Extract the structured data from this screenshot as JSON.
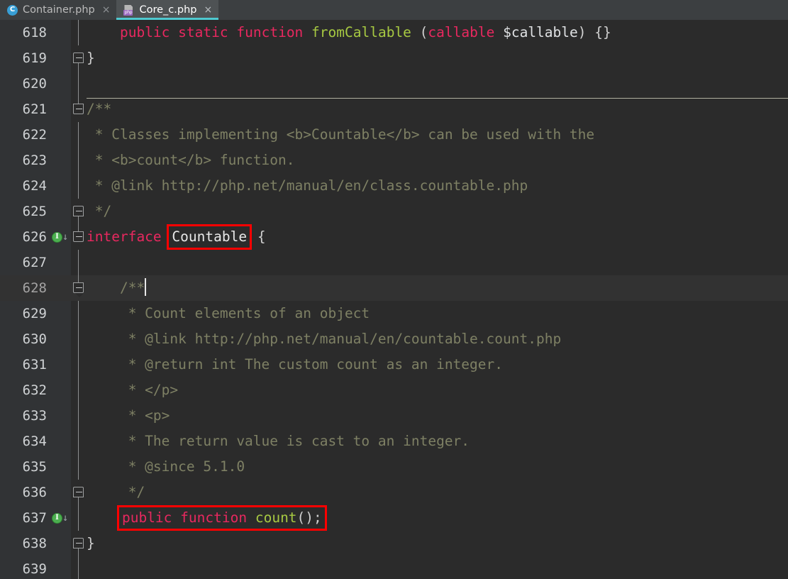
{
  "window": {
    "app": "php-editor",
    "accent_color": "#4ec9d0",
    "background": "#2b2b2b",
    "gutter_background": "#313335",
    "annotation_color": "#fe0000"
  },
  "tabs": [
    {
      "label": "Container.php",
      "icon": "php-class-icon",
      "icon_letter": "C",
      "active": false,
      "close_label": "×"
    },
    {
      "label": "Core_c.php",
      "icon": "php-file-icon",
      "icon_letter": "php",
      "active": true,
      "close_label": "×"
    }
  ],
  "editor": {
    "gutter_marker_letter": "I",
    "gutter_marker_arrow": "↓",
    "fold_collapse_label": "−",
    "lines": [
      {
        "number": "618",
        "fold": "line",
        "marker": false,
        "current": false,
        "tokens": [
          {
            "t": "    ",
            "c": "punc"
          },
          {
            "t": "public",
            "c": "kw"
          },
          {
            "t": " ",
            "c": "punc"
          },
          {
            "t": "static",
            "c": "kw"
          },
          {
            "t": " ",
            "c": "punc"
          },
          {
            "t": "function",
            "c": "kw"
          },
          {
            "t": " ",
            "c": "punc"
          },
          {
            "t": "fromCallable",
            "c": "fn"
          },
          {
            "t": " (",
            "c": "punc"
          },
          {
            "t": "callable",
            "c": "kw"
          },
          {
            "t": " ",
            "c": "punc"
          },
          {
            "t": "$callable",
            "c": "var"
          },
          {
            "t": ") {}",
            "c": "punc"
          }
        ]
      },
      {
        "number": "619",
        "fold": "end",
        "marker": false,
        "current": false,
        "tokens": [
          {
            "t": "}",
            "c": "punc"
          }
        ]
      },
      {
        "number": "620",
        "fold": "line",
        "marker": false,
        "current": false,
        "tokens": []
      },
      {
        "number": "621",
        "fold": "start",
        "marker": false,
        "current": false,
        "tokens": [
          {
            "t": "/**",
            "c": "cmt"
          }
        ]
      },
      {
        "number": "622",
        "fold": "line",
        "marker": false,
        "current": false,
        "tokens": [
          {
            "t": " * Classes implementing <b>Countable</b> can be used with the",
            "c": "cmt"
          }
        ]
      },
      {
        "number": "623",
        "fold": "line",
        "marker": false,
        "current": false,
        "tokens": [
          {
            "t": " * <b>count</b> function.",
            "c": "cmt"
          }
        ]
      },
      {
        "number": "624",
        "fold": "line",
        "marker": false,
        "current": false,
        "tokens": [
          {
            "t": " * @link http://php.net/manual/en/class.countable.php",
            "c": "cmt"
          }
        ]
      },
      {
        "number": "625",
        "fold": "end",
        "marker": false,
        "current": false,
        "tokens": [
          {
            "t": " */",
            "c": "cmt"
          }
        ]
      },
      {
        "number": "626",
        "fold": "start",
        "marker": true,
        "current": false,
        "tokens": [
          {
            "t": "interface",
            "c": "kw"
          },
          {
            "t": " ",
            "c": "punc"
          },
          {
            "t": "Countable",
            "c": "name",
            "annot": true
          },
          {
            "t": " {",
            "c": "punc"
          }
        ]
      },
      {
        "number": "627",
        "fold": "line",
        "marker": false,
        "current": false,
        "tokens": []
      },
      {
        "number": "628",
        "fold": "start",
        "marker": false,
        "current": true,
        "caret": true,
        "tokens": [
          {
            "t": "    /**",
            "c": "cmt"
          }
        ]
      },
      {
        "number": "629",
        "fold": "line",
        "marker": false,
        "current": false,
        "tokens": [
          {
            "t": "     * Count elements of an object",
            "c": "cmt"
          }
        ]
      },
      {
        "number": "630",
        "fold": "line",
        "marker": false,
        "current": false,
        "tokens": [
          {
            "t": "     * @link http://php.net/manual/en/countable.count.php",
            "c": "cmt"
          }
        ]
      },
      {
        "number": "631",
        "fold": "line",
        "marker": false,
        "current": false,
        "tokens": [
          {
            "t": "     * @return int The custom count as an integer.",
            "c": "cmt"
          }
        ]
      },
      {
        "number": "632",
        "fold": "line",
        "marker": false,
        "current": false,
        "tokens": [
          {
            "t": "     * </p>",
            "c": "cmt"
          }
        ]
      },
      {
        "number": "633",
        "fold": "line",
        "marker": false,
        "current": false,
        "tokens": [
          {
            "t": "     * <p>",
            "c": "cmt"
          }
        ]
      },
      {
        "number": "634",
        "fold": "line",
        "marker": false,
        "current": false,
        "tokens": [
          {
            "t": "     * The return value is cast to an integer.",
            "c": "cmt"
          }
        ]
      },
      {
        "number": "635",
        "fold": "line",
        "marker": false,
        "current": false,
        "tokens": [
          {
            "t": "     * @since 5.1.0",
            "c": "cmt"
          }
        ]
      },
      {
        "number": "636",
        "fold": "end",
        "marker": false,
        "current": false,
        "tokens": [
          {
            "t": "     */",
            "c": "cmt"
          }
        ]
      },
      {
        "number": "637",
        "fold": "line",
        "marker": true,
        "current": false,
        "annot_line": true,
        "tokens": [
          {
            "t": "    ",
            "c": "punc"
          },
          {
            "t": "public",
            "c": "kw"
          },
          {
            "t": " ",
            "c": "punc"
          },
          {
            "t": "function",
            "c": "kw"
          },
          {
            "t": " ",
            "c": "punc"
          },
          {
            "t": "count",
            "c": "fn"
          },
          {
            "t": "();",
            "c": "punc"
          }
        ]
      },
      {
        "number": "638",
        "fold": "end",
        "marker": false,
        "current": false,
        "tokens": [
          {
            "t": "}",
            "c": "punc"
          }
        ]
      },
      {
        "number": "639",
        "fold": "line",
        "marker": false,
        "current": false,
        "tokens": []
      }
    ]
  }
}
